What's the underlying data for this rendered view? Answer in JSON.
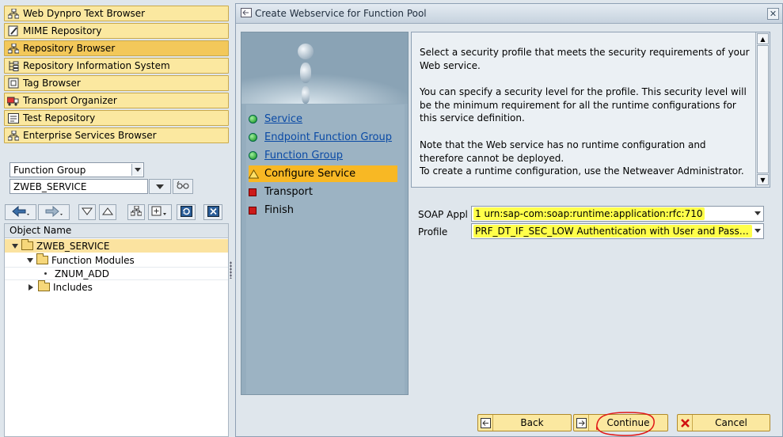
{
  "left_nav": {
    "items": [
      {
        "label": "Web Dynpro Text Browser",
        "icon": "hierarchy-icon",
        "active": false
      },
      {
        "label": "MIME Repository",
        "icon": "pencil-page-icon",
        "active": false
      },
      {
        "label": "Repository Browser",
        "icon": "hierarchy-icon",
        "active": true
      },
      {
        "label": "Repository Information System",
        "icon": "tree-icon",
        "active": false
      },
      {
        "label": "Tag Browser",
        "icon": "tag-icon",
        "active": false
      },
      {
        "label": "Transport Organizer",
        "icon": "truck-icon",
        "active": false
      },
      {
        "label": "Test Repository",
        "icon": "test-icon",
        "active": false
      },
      {
        "label": "Enterprise Services Browser",
        "icon": "hierarchy-icon",
        "active": false
      }
    ]
  },
  "object_selector": {
    "type_value": "Function Group",
    "name_value": "ZWEB_SERVICE"
  },
  "tree": {
    "header": "Object Name",
    "rows": [
      {
        "label": "ZWEB_SERVICE",
        "level": 0,
        "expanded": true,
        "selected": true
      },
      {
        "label": "Function Modules",
        "level": 1,
        "expanded": true,
        "selected": false
      },
      {
        "label": "ZNUM_ADD",
        "level": 2,
        "leaf": true,
        "selected": false
      },
      {
        "label": "Includes",
        "level": 1,
        "expanded": false,
        "selected": false
      }
    ]
  },
  "dialog": {
    "title": "Create Webservice for Function Pool",
    "steps": [
      {
        "label": "Service",
        "status": "done",
        "link": true
      },
      {
        "label": "Endpoint Function Group",
        "status": "done",
        "link": true
      },
      {
        "label": "Function Group",
        "status": "done",
        "link": true
      },
      {
        "label": "Configure Service",
        "status": "current",
        "link": false
      },
      {
        "label": "Transport",
        "status": "pending",
        "link": false
      },
      {
        "label": "Finish",
        "status": "pending",
        "link": false
      }
    ],
    "info_paragraphs": [
      "Select a security profile that meets the security requirements of your Web service.",
      "You can specify a security level for the profile. This security level will be the minimum requirement for all the runtime configurations for this service definition.",
      "Note that the Web service has no runtime configuration and therefore cannot be deployed.",
      "To create a runtime configuration, use the Netweaver Administrator."
    ],
    "fields": {
      "soap_label": "SOAP Appl",
      "soap_value": "1 urn:sap-com:soap:runtime:application:rfc:710",
      "profile_label": "Profile",
      "profile_value": "PRF_DT_IF_SEC_LOW Authentication with User and Password..."
    },
    "buttons": {
      "back": "Back",
      "continue": "Continue",
      "cancel": "Cancel"
    }
  },
  "colors": {
    "nav_button": "#fbe8a0",
    "nav_active": "#f3c85a",
    "current_step": "#f8b824",
    "field_highlight": "#ffff4a",
    "link": "#0a4aa5"
  }
}
